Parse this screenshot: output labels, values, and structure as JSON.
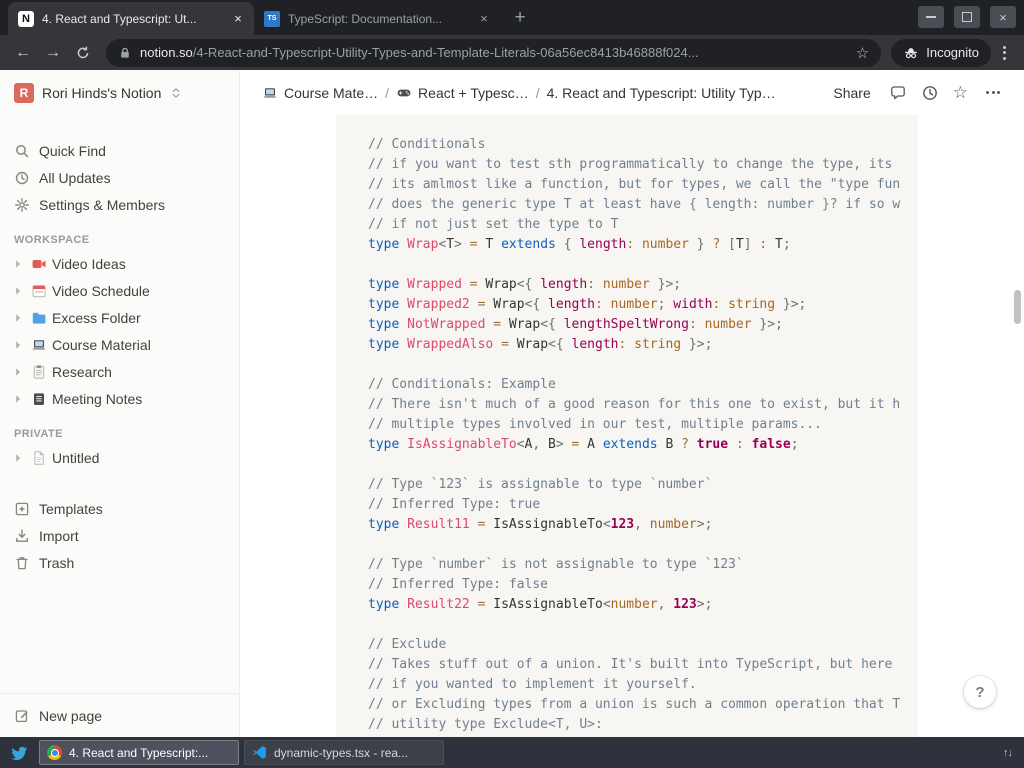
{
  "help_label": "?",
  "browser": {
    "tabs": [
      {
        "title": "4. React and Typescript: Ut...",
        "favicon_text": "N",
        "active": true
      },
      {
        "title": "TypeScript: Documentation...",
        "favicon_text": "TS",
        "active": false
      }
    ],
    "url_domain": "notion.so",
    "url_path": "/4-React-and-Typescript-Utility-Types-and-Template-Literals-06a56ec8413b46888f024...",
    "incognito_label": "Incognito"
  },
  "sidebar": {
    "workspace_name": "Rori Hinds's Notion",
    "workspace_avatar_letter": "R",
    "top_items": [
      {
        "label": "Quick Find",
        "icon": "search"
      },
      {
        "label": "All Updates",
        "icon": "clock"
      },
      {
        "label": "Settings & Members",
        "icon": "gear"
      }
    ],
    "sections": [
      {
        "title": "WORKSPACE",
        "items": [
          {
            "label": "Video Ideas",
            "icon": "camera"
          },
          {
            "label": "Video Schedule",
            "icon": "calendar"
          },
          {
            "label": "Excess Folder",
            "icon": "folder"
          },
          {
            "label": "Course Material",
            "icon": "laptop"
          },
          {
            "label": "Research",
            "icon": "clipboard"
          },
          {
            "label": "Meeting Notes",
            "icon": "notes"
          }
        ]
      },
      {
        "title": "PRIVATE",
        "items": [
          {
            "label": "Untitled",
            "icon": "page"
          }
        ]
      }
    ],
    "bottom_items": [
      {
        "label": "Templates",
        "icon": "template"
      },
      {
        "label": "Import",
        "icon": "import"
      },
      {
        "label": "Trash",
        "icon": "trash"
      }
    ],
    "new_page_label": "New page"
  },
  "topbar": {
    "breadcrumbs": [
      {
        "icon": "laptop",
        "label": "Course Mate…"
      },
      {
        "icon": "controller",
        "label": "React + Typesc…"
      },
      {
        "icon": "",
        "label": "4. React and Typescript: Utility Typ…"
      }
    ],
    "share_label": "Share"
  },
  "code": {
    "language": "typescript",
    "lines": [
      [
        [
          "c",
          "// Conditionals"
        ]
      ],
      [
        [
          "c",
          "// if you want to test sth programmatically to change the type, its"
        ]
      ],
      [
        [
          "c",
          "// its amlmost like a function, but for types, we call the \"type fun"
        ]
      ],
      [
        [
          "c",
          "// does the generic type T at least have { length: number }? if so w"
        ]
      ],
      [
        [
          "c",
          "// if not just set the type to T"
        ]
      ],
      [
        [
          "k",
          "type"
        ],
        [
          "pl",
          " "
        ],
        [
          "cn",
          "Wrap"
        ],
        [
          "p",
          "<"
        ],
        [
          "pl",
          "T"
        ],
        [
          "p",
          "> "
        ],
        [
          "o",
          "="
        ],
        [
          "pl",
          " T "
        ],
        [
          "k",
          "extends"
        ],
        [
          "pl",
          " "
        ],
        [
          "p",
          "{ "
        ],
        [
          "pr",
          "length"
        ],
        [
          "o",
          ":"
        ],
        [
          "pl",
          " "
        ],
        [
          "b",
          "number"
        ],
        [
          "p",
          " } "
        ],
        [
          "o",
          "?"
        ],
        [
          "pl",
          " "
        ],
        [
          "p",
          "["
        ],
        [
          "pl",
          "T"
        ],
        [
          "p",
          "]"
        ],
        [
          "pl",
          " "
        ],
        [
          "o",
          ":"
        ],
        [
          "pl",
          " T"
        ],
        [
          "p",
          ";"
        ]
      ],
      [],
      [
        [
          "k",
          "type"
        ],
        [
          "pl",
          " "
        ],
        [
          "cn",
          "Wrapped"
        ],
        [
          "pl",
          " "
        ],
        [
          "o",
          "="
        ],
        [
          "pl",
          " Wrap"
        ],
        [
          "p",
          "<{ "
        ],
        [
          "pr",
          "length"
        ],
        [
          "o",
          ":"
        ],
        [
          "pl",
          " "
        ],
        [
          "b",
          "number"
        ],
        [
          "p",
          " }>;"
        ]
      ],
      [
        [
          "k",
          "type"
        ],
        [
          "pl",
          " "
        ],
        [
          "cn",
          "Wrapped2"
        ],
        [
          "pl",
          " "
        ],
        [
          "o",
          "="
        ],
        [
          "pl",
          " Wrap"
        ],
        [
          "p",
          "<{ "
        ],
        [
          "pr",
          "length"
        ],
        [
          "o",
          ":"
        ],
        [
          "pl",
          " "
        ],
        [
          "b",
          "number"
        ],
        [
          "p",
          "; "
        ],
        [
          "pr",
          "width"
        ],
        [
          "o",
          ":"
        ],
        [
          "pl",
          " "
        ],
        [
          "b",
          "string"
        ],
        [
          "p",
          " }>;"
        ]
      ],
      [
        [
          "k",
          "type"
        ],
        [
          "pl",
          " "
        ],
        [
          "cn",
          "NotWrapped"
        ],
        [
          "pl",
          " "
        ],
        [
          "o",
          "="
        ],
        [
          "pl",
          " Wrap"
        ],
        [
          "p",
          "<{ "
        ],
        [
          "pr",
          "lengthSpeltWrong"
        ],
        [
          "o",
          ":"
        ],
        [
          "pl",
          " "
        ],
        [
          "b",
          "number"
        ],
        [
          "p",
          " }>;"
        ]
      ],
      [
        [
          "k",
          "type"
        ],
        [
          "pl",
          " "
        ],
        [
          "cn",
          "WrappedAlso"
        ],
        [
          "pl",
          " "
        ],
        [
          "o",
          "="
        ],
        [
          "pl",
          " Wrap"
        ],
        [
          "p",
          "<{ "
        ],
        [
          "pr",
          "length"
        ],
        [
          "o",
          ":"
        ],
        [
          "pl",
          " "
        ],
        [
          "b",
          "string"
        ],
        [
          "p",
          " }>;"
        ]
      ],
      [],
      [
        [
          "c",
          "// Conditionals: Example"
        ]
      ],
      [
        [
          "c",
          "// There isn't much of a good reason for this one to exist, but it h"
        ]
      ],
      [
        [
          "c",
          "// multiple types involved in our test, multiple params..."
        ]
      ],
      [
        [
          "k",
          "type"
        ],
        [
          "pl",
          " "
        ],
        [
          "cn",
          "IsAssignableTo"
        ],
        [
          "p",
          "<"
        ],
        [
          "pl",
          "A"
        ],
        [
          "p",
          ", "
        ],
        [
          "pl",
          "B"
        ],
        [
          "p",
          "> "
        ],
        [
          "o",
          "="
        ],
        [
          "pl",
          " A "
        ],
        [
          "k",
          "extends"
        ],
        [
          "pl",
          " B "
        ],
        [
          "o",
          "?"
        ],
        [
          "pl",
          " "
        ],
        [
          "bo",
          "true"
        ],
        [
          "pl",
          " "
        ],
        [
          "o",
          ":"
        ],
        [
          "pl",
          " "
        ],
        [
          "bo",
          "false"
        ],
        [
          "p",
          ";"
        ]
      ],
      [],
      [
        [
          "c",
          "// Type `123` is assignable to type `number`"
        ]
      ],
      [
        [
          "c",
          "// Inferred Type: true"
        ]
      ],
      [
        [
          "k",
          "type"
        ],
        [
          "pl",
          " "
        ],
        [
          "cn",
          "Result11"
        ],
        [
          "pl",
          " "
        ],
        [
          "o",
          "="
        ],
        [
          "pl",
          " IsAssignableTo"
        ],
        [
          "p",
          "<"
        ],
        [
          "bo",
          "123"
        ],
        [
          "p",
          ", "
        ],
        [
          "b",
          "number"
        ],
        [
          "p",
          ">;"
        ]
      ],
      [],
      [
        [
          "c",
          "// Type `number` is not assignable to type `123`"
        ]
      ],
      [
        [
          "c",
          "// Inferred Type: false"
        ]
      ],
      [
        [
          "k",
          "type"
        ],
        [
          "pl",
          " "
        ],
        [
          "cn",
          "Result22"
        ],
        [
          "pl",
          " "
        ],
        [
          "o",
          "="
        ],
        [
          "pl",
          " IsAssignableTo"
        ],
        [
          "p",
          "<"
        ],
        [
          "b",
          "number"
        ],
        [
          "p",
          ", "
        ],
        [
          "bo",
          "123"
        ],
        [
          "p",
          ">;"
        ]
      ],
      [],
      [
        [
          "c",
          "// Exclude"
        ]
      ],
      [
        [
          "c",
          "// Takes stuff out of a union. It's built into TypeScript, but here"
        ]
      ],
      [
        [
          "c",
          "// if you wanted to implement it yourself."
        ]
      ],
      [
        [
          "c",
          "// or Excluding types from a union is such a common operation that T"
        ]
      ],
      [
        [
          "c",
          "// utility type Exclude<T, U>:"
        ]
      ]
    ]
  },
  "taskbar": {
    "tasks": [
      {
        "icon": "chromium",
        "title": "4. React and Typescript:...",
        "active": true
      },
      {
        "icon": "vscode",
        "title": "dynamic-types.tsx - rea...",
        "active": false
      }
    ]
  }
}
